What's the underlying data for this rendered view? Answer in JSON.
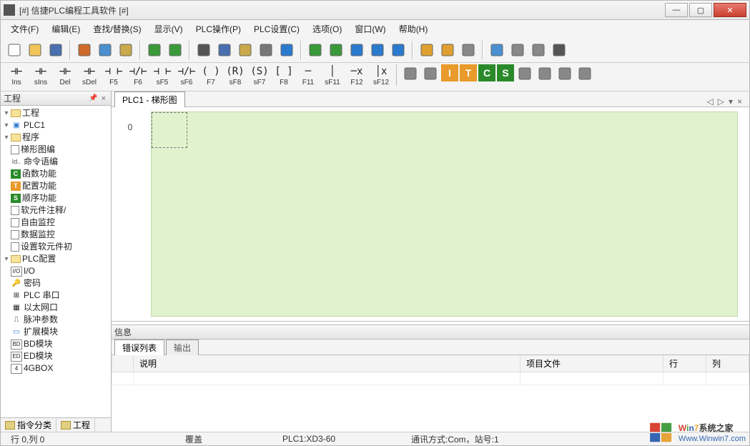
{
  "window": {
    "title": "[#] 信捷PLC编程工具软件 [#]"
  },
  "menu": [
    "文件(F)",
    "编辑(E)",
    "查找/替换(S)",
    "显示(V)",
    "PLC操作(P)",
    "PLC设置(C)",
    "选项(O)",
    "窗口(W)",
    "帮助(H)"
  ],
  "toolbar1_icons": [
    "new",
    "open",
    "save",
    "cut",
    "copy",
    "paste",
    "undo",
    "redo",
    "find",
    "grid",
    "list",
    "print",
    "help",
    "download",
    "upload",
    "run-step",
    "run",
    "stop",
    "lock",
    "unlock",
    "compare",
    "table",
    "zoom",
    "config",
    "serial"
  ],
  "toolbar2": [
    {
      "sym": "⊣⊢",
      "lbl": "Ins"
    },
    {
      "sym": "⊣⊢",
      "lbl": "sIns"
    },
    {
      "sym": "⊣⊢",
      "lbl": "Del"
    },
    {
      "sym": "⊣⊢",
      "lbl": "sDel"
    },
    {
      "sym": "⊣ ⊢",
      "lbl": "F5"
    },
    {
      "sym": "⊣/⊢",
      "lbl": "F6"
    },
    {
      "sym": "⊣ ⊢",
      "lbl": "sF5"
    },
    {
      "sym": "⊣/⊢",
      "lbl": "sF6"
    },
    {
      "sym": "( )",
      "lbl": "F7"
    },
    {
      "sym": "(R)",
      "lbl": "sF8"
    },
    {
      "sym": "(S)",
      "lbl": "sF7"
    },
    {
      "sym": "[ ]",
      "lbl": "F8"
    },
    {
      "sym": "─",
      "lbl": "F11"
    },
    {
      "sym": "│",
      "lbl": "sF11"
    },
    {
      "sym": "─x",
      "lbl": "F12"
    },
    {
      "sym": "│x",
      "lbl": "sF12"
    }
  ],
  "toolbar2_extra_icons": [
    "del-h",
    "del-v",
    "I",
    "T",
    "C",
    "S",
    "link",
    "zoom-in",
    "zoom-out",
    "ladder-view"
  ],
  "sidebar": {
    "title": "工程",
    "bottom_tabs": [
      "指令分类",
      "工程"
    ],
    "tree": [
      {
        "ind": 0,
        "tw": "▾",
        "icon": "fold",
        "label": "工程"
      },
      {
        "ind": 1,
        "tw": "▾",
        "icon": "plc",
        "label": "PLC1"
      },
      {
        "ind": 2,
        "tw": "▾",
        "icon": "fold",
        "label": "程序"
      },
      {
        "ind": 3,
        "tw": "",
        "icon": "page",
        "label": "梯形图编"
      },
      {
        "ind": 3,
        "tw": "",
        "icon": "id",
        "label": "命令语编"
      },
      {
        "ind": 3,
        "tw": "",
        "icon": "sq-g",
        "label": "函数功能"
      },
      {
        "ind": 3,
        "tw": "",
        "icon": "sq-o",
        "label": "配置功能"
      },
      {
        "ind": 3,
        "tw": "",
        "icon": "sq-gn",
        "label": "顺序功能"
      },
      {
        "ind": 2,
        "tw": "",
        "icon": "page",
        "label": "软元件注释/"
      },
      {
        "ind": 2,
        "tw": "",
        "icon": "page",
        "label": "自由监控"
      },
      {
        "ind": 2,
        "tw": "",
        "icon": "page",
        "label": "数据监控"
      },
      {
        "ind": 2,
        "tw": "",
        "icon": "page",
        "label": "设置软元件初"
      },
      {
        "ind": 2,
        "tw": "▾",
        "icon": "fold",
        "label": "PLC配置"
      },
      {
        "ind": 3,
        "tw": "",
        "icon": "io",
        "label": "I/O"
      },
      {
        "ind": 3,
        "tw": "",
        "icon": "pw",
        "label": "密码"
      },
      {
        "ind": 3,
        "tw": "",
        "icon": "ser",
        "label": "PLC 串口"
      },
      {
        "ind": 3,
        "tw": "",
        "icon": "eth",
        "label": "以太网口"
      },
      {
        "ind": 3,
        "tw": "",
        "icon": "pls",
        "label": "脉冲参数"
      },
      {
        "ind": 3,
        "tw": "",
        "icon": "ext",
        "label": "扩展模块"
      },
      {
        "ind": 3,
        "tw": "",
        "icon": "bd",
        "label": "BD模块"
      },
      {
        "ind": 3,
        "tw": "",
        "icon": "ed",
        "label": "ED模块"
      },
      {
        "ind": 3,
        "tw": "",
        "icon": "4g",
        "label": "4GBOX"
      }
    ]
  },
  "editor": {
    "tab": "PLC1 - 梯形图",
    "row0": "0"
  },
  "info": {
    "title": "信息",
    "tabs": [
      "错误列表",
      "输出"
    ],
    "columns": [
      "",
      "说明",
      "项目文件",
      "行",
      "列"
    ]
  },
  "status": {
    "pos": "行 0,列 0",
    "mode": "覆盖",
    "plc": "PLC1:XD3-60",
    "comm": "通讯方式:Com，站号:1"
  },
  "watermark": {
    "brand": "Win7系统之家",
    "url": "Www.Winwin7.com"
  }
}
